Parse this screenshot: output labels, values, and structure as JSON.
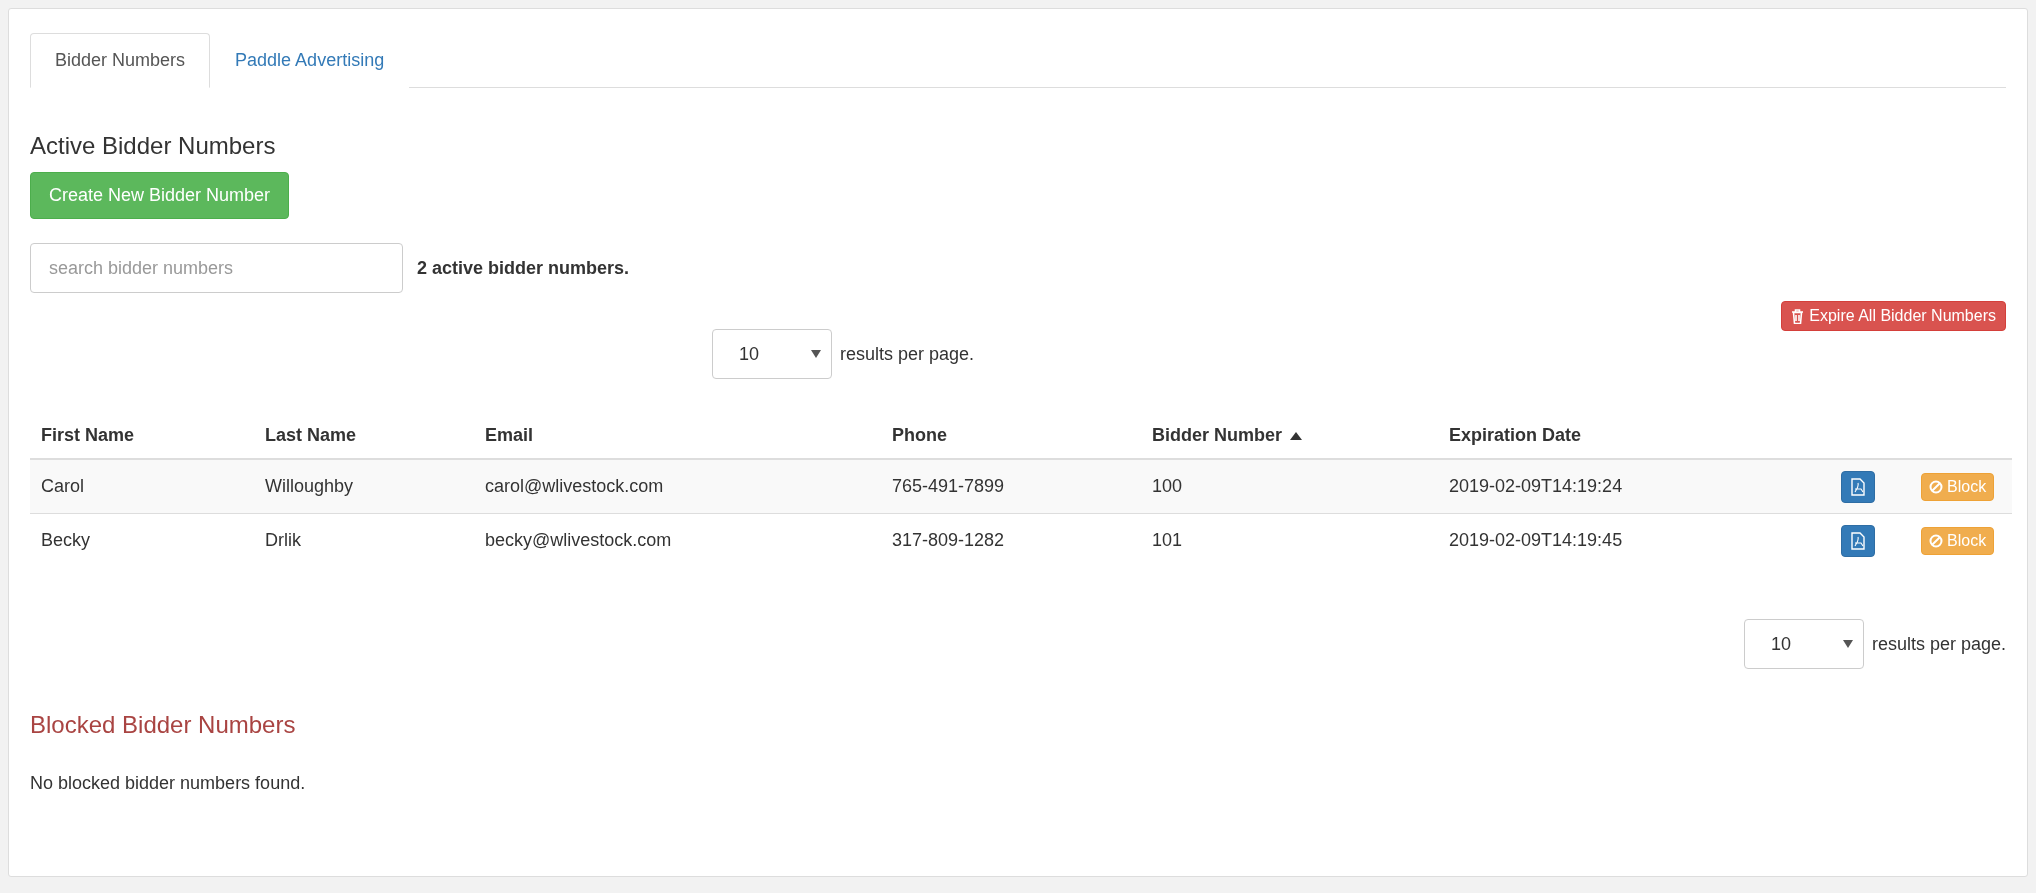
{
  "tabs": [
    {
      "label": "Bidder Numbers",
      "selected": true
    },
    {
      "label": "Paddle Advertising",
      "selected": false
    }
  ],
  "active": {
    "title": "Active Bidder Numbers",
    "create_button": "Create New Bidder Number",
    "search": {
      "placeholder": "search bidder numbers"
    },
    "count_text": "2 active bidder numbers.",
    "expire_button": "Expire All Bidder Numbers",
    "top_pager": {
      "value": "10",
      "label": "results per page."
    },
    "table": {
      "columns": [
        {
          "label": "First Name",
          "sorted": false
        },
        {
          "label": "Last Name",
          "sorted": false
        },
        {
          "label": "Email",
          "sorted": false
        },
        {
          "label": "Phone",
          "sorted": false
        },
        {
          "label": "Bidder Number",
          "sorted": true
        },
        {
          "label": "Expiration Date",
          "sorted": false
        }
      ],
      "rows": [
        {
          "cells": [
            "Carol",
            "Willoughby",
            "carol@wlivestock.com",
            "765-491-7899",
            "100",
            "2019-02-09T14:19:24"
          ],
          "block_label": "Block"
        },
        {
          "cells": [
            "Becky",
            "Drlik",
            "becky@wlivestock.com",
            "317-809-1282",
            "101",
            "2019-02-09T14:19:45"
          ],
          "block_label": "Block"
        }
      ]
    },
    "bottom_pager": {
      "value": "10",
      "label": "results per page."
    }
  },
  "blocked": {
    "title": "Blocked Bidder Numbers",
    "empty_text": "No blocked bidder numbers found."
  }
}
